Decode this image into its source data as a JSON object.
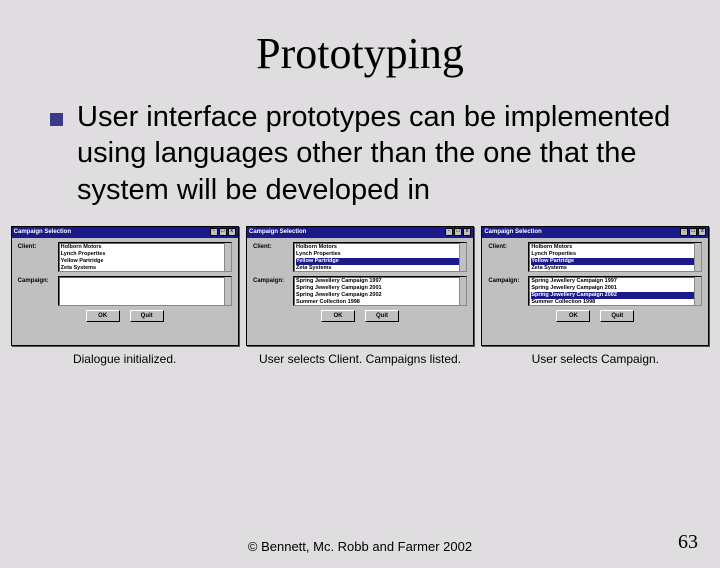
{
  "title": "Prototyping",
  "body": "User interface prototypes can be implemented using languages other than the one that the system will be developed in",
  "windows": {
    "titlebarTitle": "Campaign Selection",
    "labels": {
      "client": "Client:",
      "campaign": "Campaign:"
    },
    "buttons": {
      "ok": "OK",
      "quit": "Quit"
    },
    "clientList": {
      "items": [
        "Holborn Motors",
        "Lynch Properties",
        "Yellow Partridge",
        "Zeta Systems"
      ]
    },
    "campaignList": {
      "items": [
        "Spring Jewellery Campaign 1997",
        "Spring Jewellery Campaign 2001",
        "Spring Jewellery Campaign 2002",
        "Summer Collection 1998"
      ]
    },
    "selections": {
      "panel2_client": "Yellow Partridge",
      "panel3_client": "Yellow Partridge",
      "panel3_campaign": "Spring Jewellery Campaign 2002"
    }
  },
  "captions": {
    "p1": "Dialogue initialized.",
    "p2": "User selects Client. Campaigns listed.",
    "p3": "User selects Campaign."
  },
  "footer": {
    "copy": "© Bennett, Mc. Robb and Farmer 2002",
    "page": "63"
  }
}
